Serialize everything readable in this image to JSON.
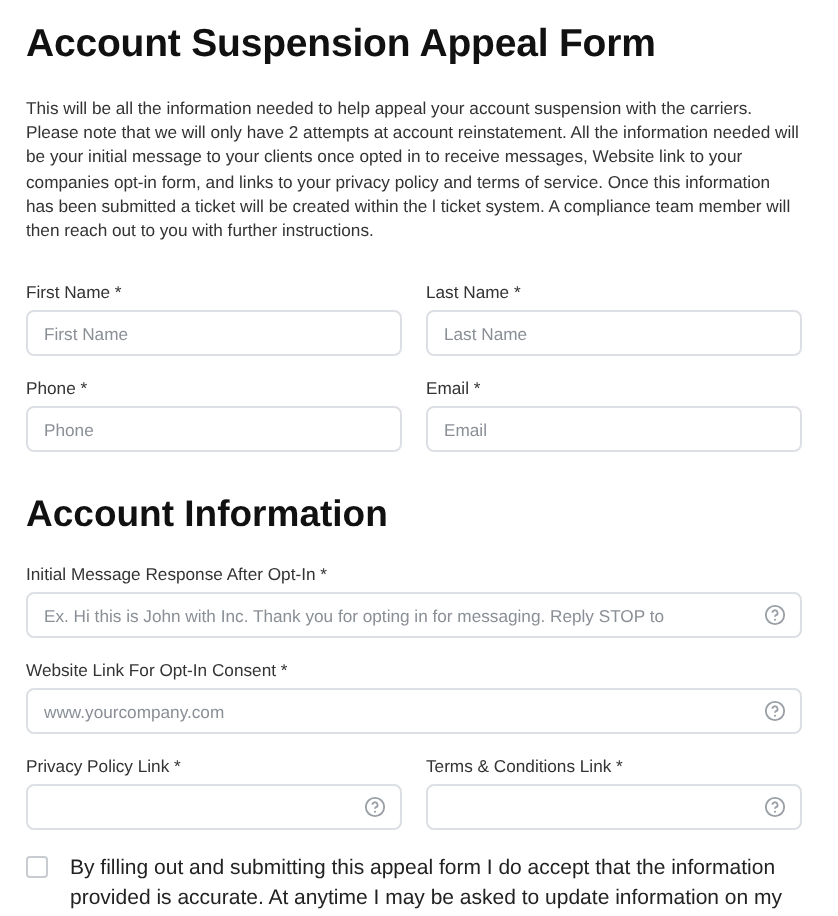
{
  "title": "Account Suspension Appeal Form",
  "intro": "This will be all the information needed to help appeal your account suspension with the carriers. Please note that we will only have 2 attempts at account reinstatement. All the information needed will be  your initial message to your clients once opted in to receive messages,  Website link to your companies opt-in form, and links to your privacy  policy and terms of service. Once this information has been submitted a ticket will be created within the l ticket system. A compliance team member will then reach out to you with further instructions.",
  "contact_fields": [
    {
      "label": "First Name *",
      "placeholder": "First Name",
      "help": false
    },
    {
      "label": "Last Name *",
      "placeholder": "Last Name",
      "help": false
    },
    {
      "label": "Phone *",
      "placeholder": "Phone",
      "help": false
    },
    {
      "label": "Email *",
      "placeholder": "Email",
      "help": false
    }
  ],
  "section_title": "Account Information",
  "account_fields": [
    {
      "label": "Initial Message Response After Opt-In *",
      "placeholder": "Ex. Hi this is John with Inc. Thank you for opting in for messaging. Reply STOP to",
      "help": true,
      "wide": true
    },
    {
      "label": "Website Link For Opt-In Consent *",
      "placeholder": "www.yourcompany.com",
      "help": true,
      "wide": true
    },
    {
      "label": "Privacy Policy Link *",
      "help": true,
      "wide": false
    },
    {
      "label": "Terms & Conditions Link *",
      "help": true,
      "wide": false
    }
  ],
  "agreement": {
    "checked": false,
    "text": "By filling out and submitting this appeal form I do accept that the information provided is accurate. At anytime I may be asked to update information on my"
  }
}
